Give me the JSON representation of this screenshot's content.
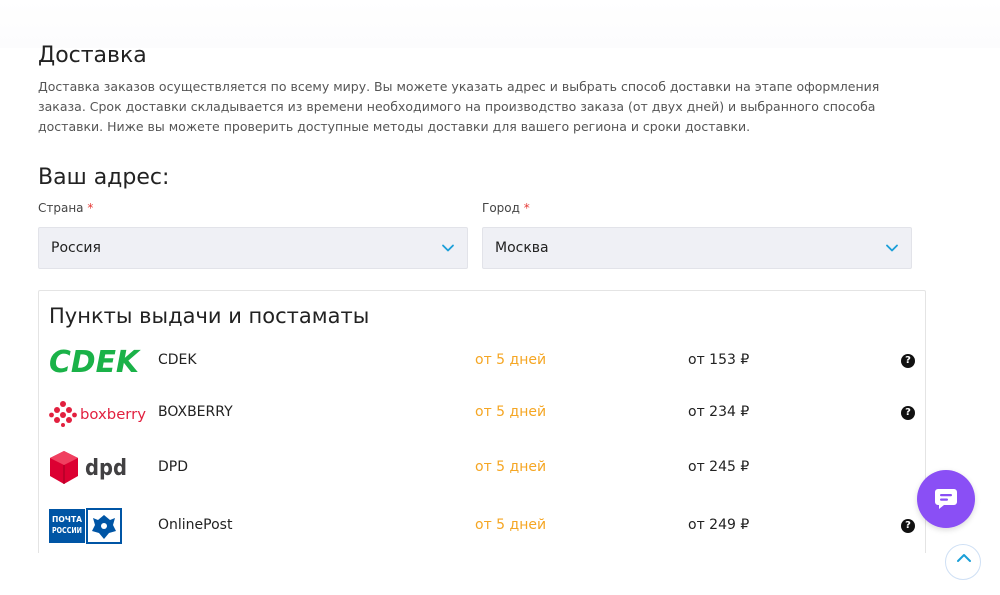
{
  "page": {
    "title": "Доставка",
    "description": "Доставка заказов осуществляется по всему миру. Вы можете указать адрес и выбрать способ доставки на этапе оформления заказа. Срок доставки складывается из времени необходимого на производство заказа (от двух дней) и выбранного способа доставки. Ниже вы можете проверить доступные методы доставки для вашего региона и сроки доставки."
  },
  "address": {
    "heading": "Ваш адрес:",
    "country": {
      "label": "Страна",
      "required_mark": "*",
      "value": "Россия"
    },
    "city": {
      "label": "Город",
      "required_mark": "*",
      "value": "Москва"
    }
  },
  "pickup": {
    "heading": "Пункты выдачи и постаматы",
    "rows": [
      {
        "logo_text": "CDEK",
        "name": "CDEK",
        "time": "от 5 дней",
        "price": "от 153 ₽",
        "help": "?"
      },
      {
        "logo_text": "boxberry",
        "name": "BOXBERRY",
        "time": "от 5 дней",
        "price": "от 234 ₽",
        "help": "?"
      },
      {
        "logo_text": "dpd",
        "name": "DPD",
        "time": "от 5 дней",
        "price": "от 245 ₽"
      },
      {
        "logo_text": "ПОЧТА РОССИИ",
        "name": "OnlinePost",
        "time": "от 5 дней",
        "price": "от 249 ₽",
        "help": "?"
      }
    ]
  },
  "colors": {
    "accent_time": "#f5a623",
    "cdek_green": "#1ab248",
    "boxberry_red": "#e2203f",
    "dpd_red": "#dc0032",
    "russian_post_blue": "#0055a5",
    "chat_purple": "#8a4ff5",
    "chevron_blue": "#1a9fd8"
  },
  "icons": {
    "select_chevron": "chevron-down-icon",
    "help": "question-icon",
    "chat": "chat-icon",
    "scroll_top": "chevron-up-icon"
  }
}
